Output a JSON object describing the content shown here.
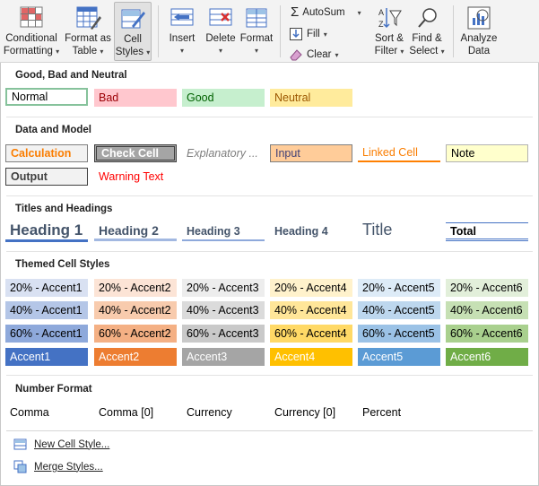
{
  "ribbon": {
    "conditional_formatting": [
      "Conditional",
      "Formatting"
    ],
    "format_as_table": [
      "Format as",
      "Table"
    ],
    "cell_styles": [
      "Cell",
      "Styles"
    ],
    "insert": "Insert",
    "delete": "Delete",
    "format": "Format",
    "autosum": "AutoSum",
    "fill": "Fill",
    "clear": "Clear",
    "sort_filter": [
      "Sort &",
      "Filter"
    ],
    "find_select": [
      "Find &",
      "Select"
    ],
    "analyze_data": [
      "Analyze",
      "Data"
    ]
  },
  "sections": {
    "good_bad": "Good, Bad and Neutral",
    "data_model": "Data and Model",
    "titles": "Titles and Headings",
    "themed": "Themed Cell Styles",
    "number": "Number Format"
  },
  "styles": {
    "good_bad": [
      "Normal",
      "Bad",
      "Good",
      "Neutral"
    ],
    "data_model": [
      "Calculation",
      "Check Cell",
      "Explanatory ...",
      "Input",
      "Linked Cell",
      "Note",
      "Output",
      "Warning Text"
    ],
    "titles": [
      "Heading 1",
      "Heading 2",
      "Heading 3",
      "Heading 4",
      "Title",
      "Total"
    ],
    "themed_20": [
      "20% - Accent1",
      "20% - Accent2",
      "20% - Accent3",
      "20% - Accent4",
      "20% - Accent5",
      "20% - Accent6"
    ],
    "themed_40": [
      "40% - Accent1",
      "40% - Accent2",
      "40% - Accent3",
      "40% - Accent4",
      "40% - Accent5",
      "40% - Accent6"
    ],
    "themed_60": [
      "60% - Accent1",
      "60% - Accent2",
      "60% - Accent3",
      "60% - Accent4",
      "60% - Accent5",
      "60% - Accent6"
    ],
    "themed_100": [
      "Accent1",
      "Accent2",
      "Accent3",
      "Accent4",
      "Accent5",
      "Accent6"
    ],
    "number": [
      "Comma",
      "Comma [0]",
      "Currency",
      "Currency [0]",
      "Percent"
    ]
  },
  "menu": {
    "new_style": "New Cell Style...",
    "merge_styles": "Merge Styles..."
  },
  "colors": {
    "accent1": "#4472c4",
    "accent2": "#ed7d31",
    "accent3": "#a5a5a5",
    "accent4": "#ffc000",
    "accent5": "#5b9bd5",
    "accent6": "#70ad47"
  }
}
